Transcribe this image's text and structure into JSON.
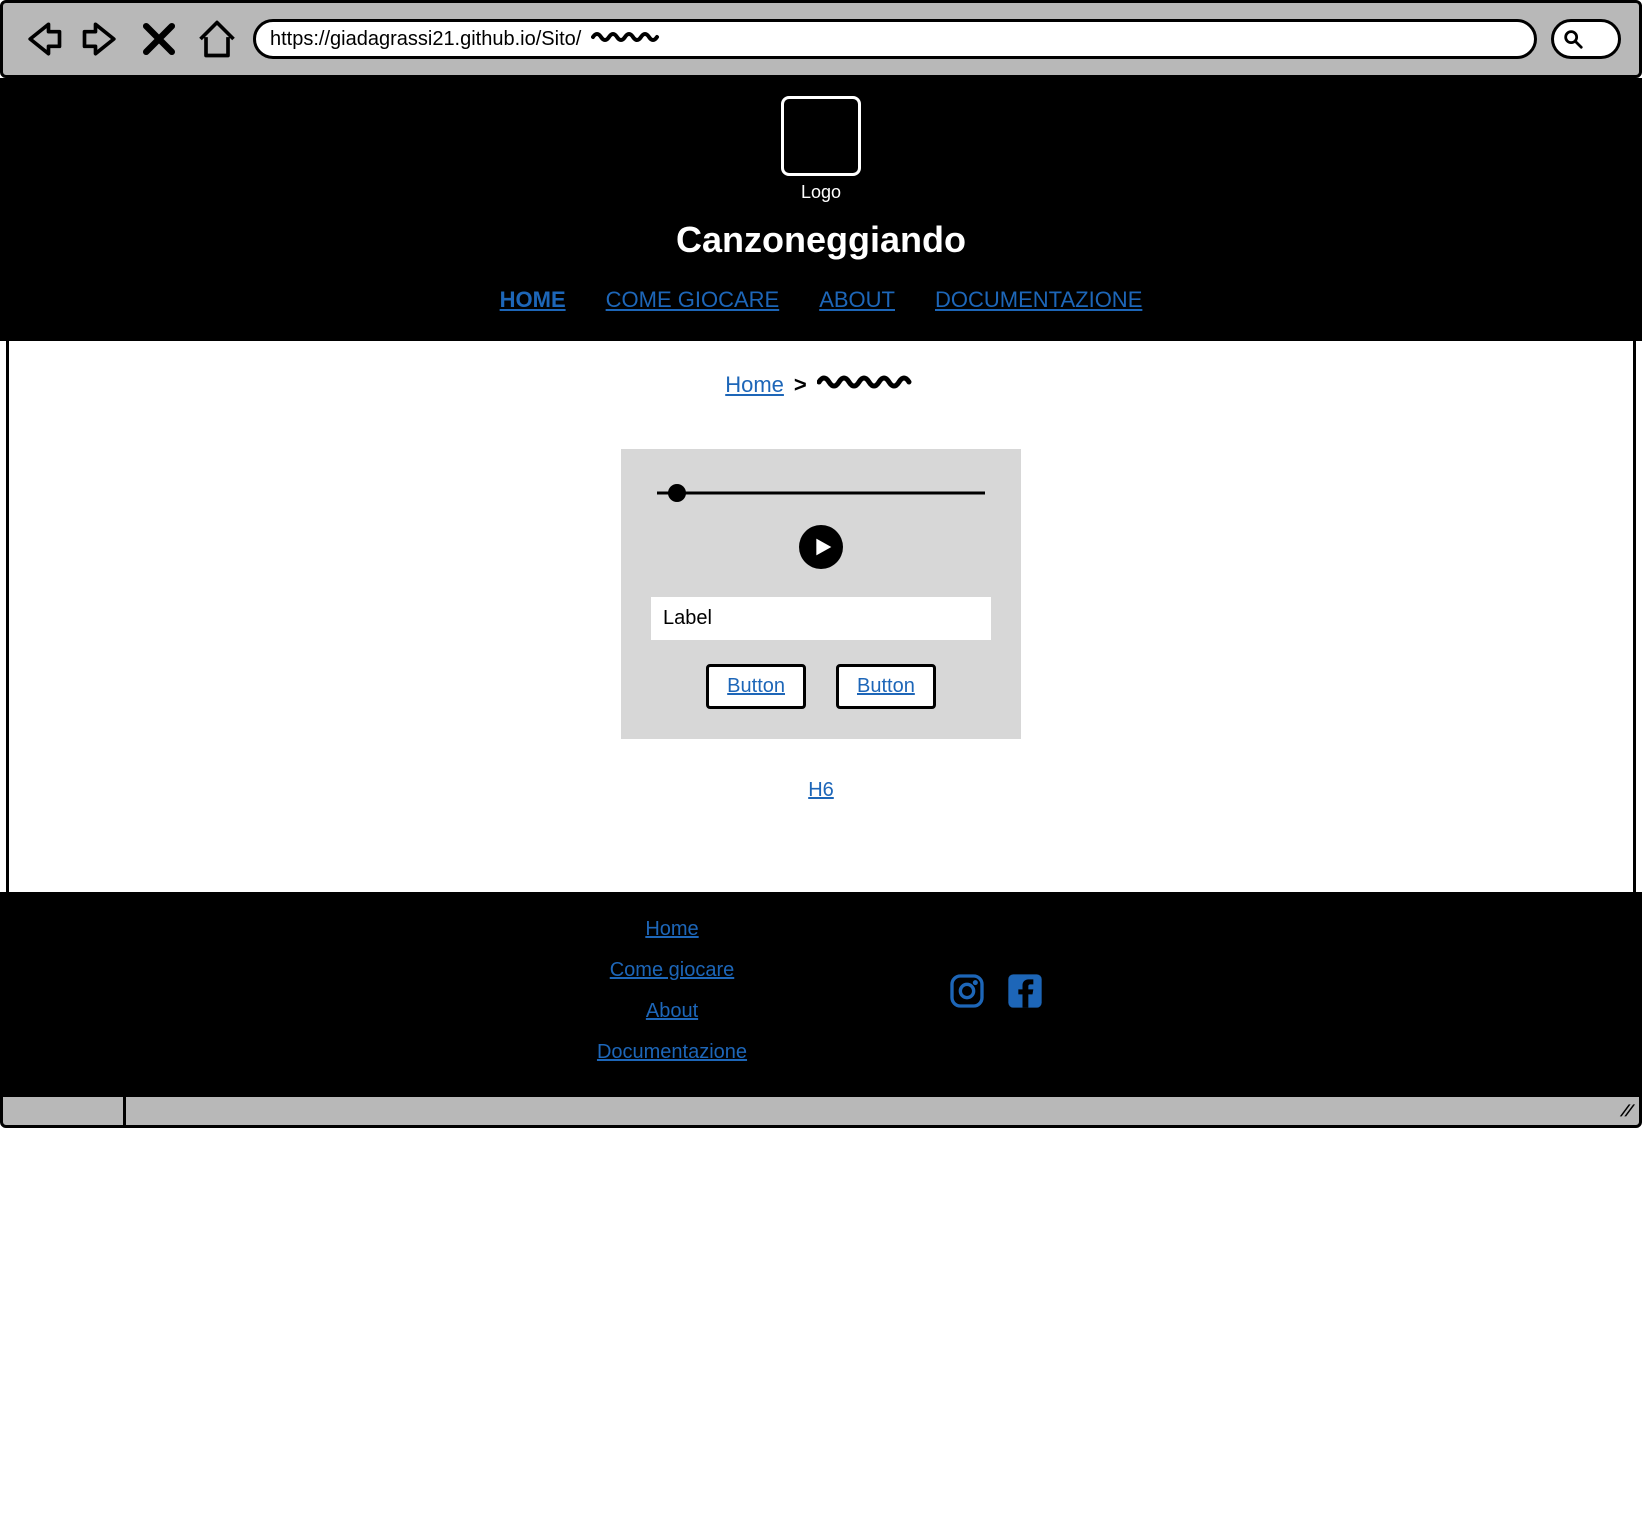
{
  "browser": {
    "url": "https://giadagrassi21.github.io/Sito/",
    "url_squiggle": "~~~~~"
  },
  "header": {
    "logo_label": "Logo",
    "title": "Canzoneggiando"
  },
  "nav": {
    "items": [
      {
        "label": "HOME",
        "active": true
      },
      {
        "label": "COME GIOCARE",
        "active": false
      },
      {
        "label": "ABOUT",
        "active": false
      },
      {
        "label": "DOCUMENTAZIONE",
        "active": false
      }
    ]
  },
  "breadcrumb": {
    "home": "Home",
    "current_squiggle": "~~~~~~"
  },
  "player": {
    "slider_value_pct": 6,
    "input_placeholder": "Label",
    "button1": "Button",
    "button2": "Button"
  },
  "below_card_link": "H6",
  "footer": {
    "links": [
      "Home",
      "Come giocare",
      "About",
      "Documentazione"
    ]
  }
}
